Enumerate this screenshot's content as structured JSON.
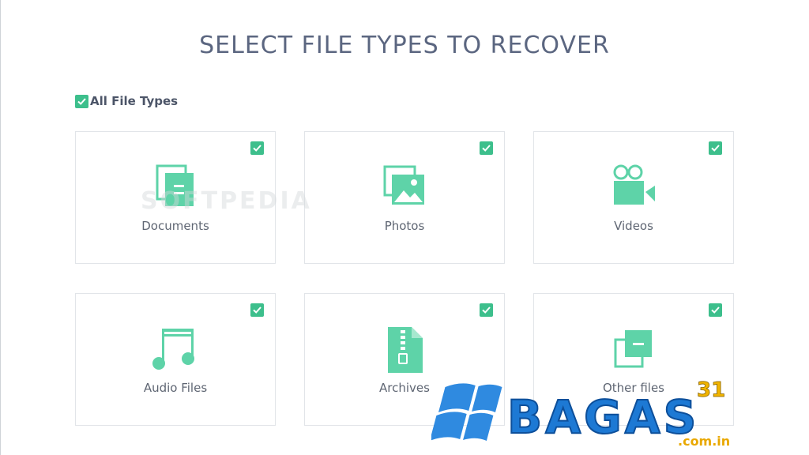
{
  "title": "SELECT FILE TYPES TO RECOVER",
  "all_file_types": {
    "label": "All File Types",
    "checked": true
  },
  "file_types": [
    {
      "label": "Documents",
      "icon": "document-icon",
      "checked": true
    },
    {
      "label": "Photos",
      "icon": "photo-icon",
      "checked": true
    },
    {
      "label": "Videos",
      "icon": "video-camera-icon",
      "checked": true
    },
    {
      "label": "Audio Files",
      "icon": "music-note-icon",
      "checked": true
    },
    {
      "label": "Archives",
      "icon": "archive-icon",
      "checked": true
    },
    {
      "label": "Other files",
      "icon": "other-files-icon",
      "checked": true
    }
  ],
  "watermarks": {
    "softpedia": "SOFTPEDIA",
    "logo_text": "BAGAS",
    "logo_number": "31",
    "logo_domain": ".com.in"
  },
  "colors": {
    "accent": "#3dbf8c",
    "icon": "#5ed3a8",
    "title": "#5b6680",
    "card_border": "#e2e5e9"
  }
}
